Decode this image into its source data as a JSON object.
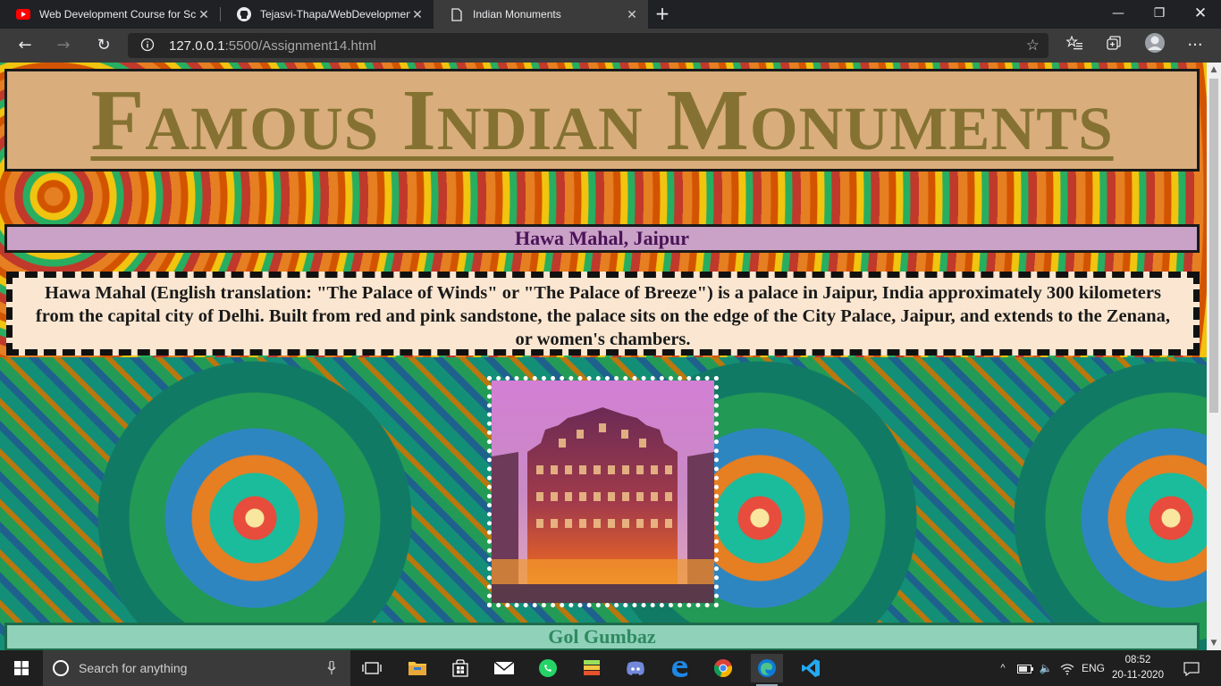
{
  "browser": {
    "tabs": [
      {
        "title": "Web Development Course for Sc",
        "icon": "youtube-icon",
        "active": false
      },
      {
        "title": "Tejasvi-Thapa/WebDevelopment",
        "icon": "github-icon",
        "active": false
      },
      {
        "title": "Indian Monuments",
        "icon": "page-icon",
        "active": true
      }
    ],
    "url_host": "127.0.0.1",
    "url_rest": ":5500/Assignment14.html"
  },
  "page": {
    "title": "Famous Indian Monuments",
    "sections": [
      {
        "heading": "Hawa Mahal, Jaipur",
        "description": "Hawa Mahal (English translation: \"The Palace of Winds\" or \"The Palace of Breeze\") is a palace in Jaipur, India approximately 300 kilometers from the capital city of Delhi. Built from red and pink sandstone, the palace sits on the edge of the City Palace, Jaipur, and extends to the Zenana, or women's chambers."
      },
      {
        "heading": "Gol Gumbaz"
      }
    ]
  },
  "colors": {
    "title_bg": "#d9ad7c",
    "title_text": "#857232",
    "heading1_bg": "#caa1c7",
    "heading1_text": "#4a1357",
    "desc_bg": "#fbe7d1",
    "heading2_bg": "#8fd1b9",
    "heading2_text": "#2f8a60"
  },
  "taskbar": {
    "search_placeholder": "Search for anything",
    "language": "ENG",
    "time": "08:52",
    "date": "20-11-2020",
    "apps": [
      "task-view-icon",
      "file-explorer-icon",
      "store-icon",
      "mail-icon",
      "whatsapp-icon",
      "bluestacks-icon",
      "discord-icon",
      "edge-legacy-icon",
      "chrome-icon",
      "edge-icon",
      "vscode-icon"
    ]
  }
}
